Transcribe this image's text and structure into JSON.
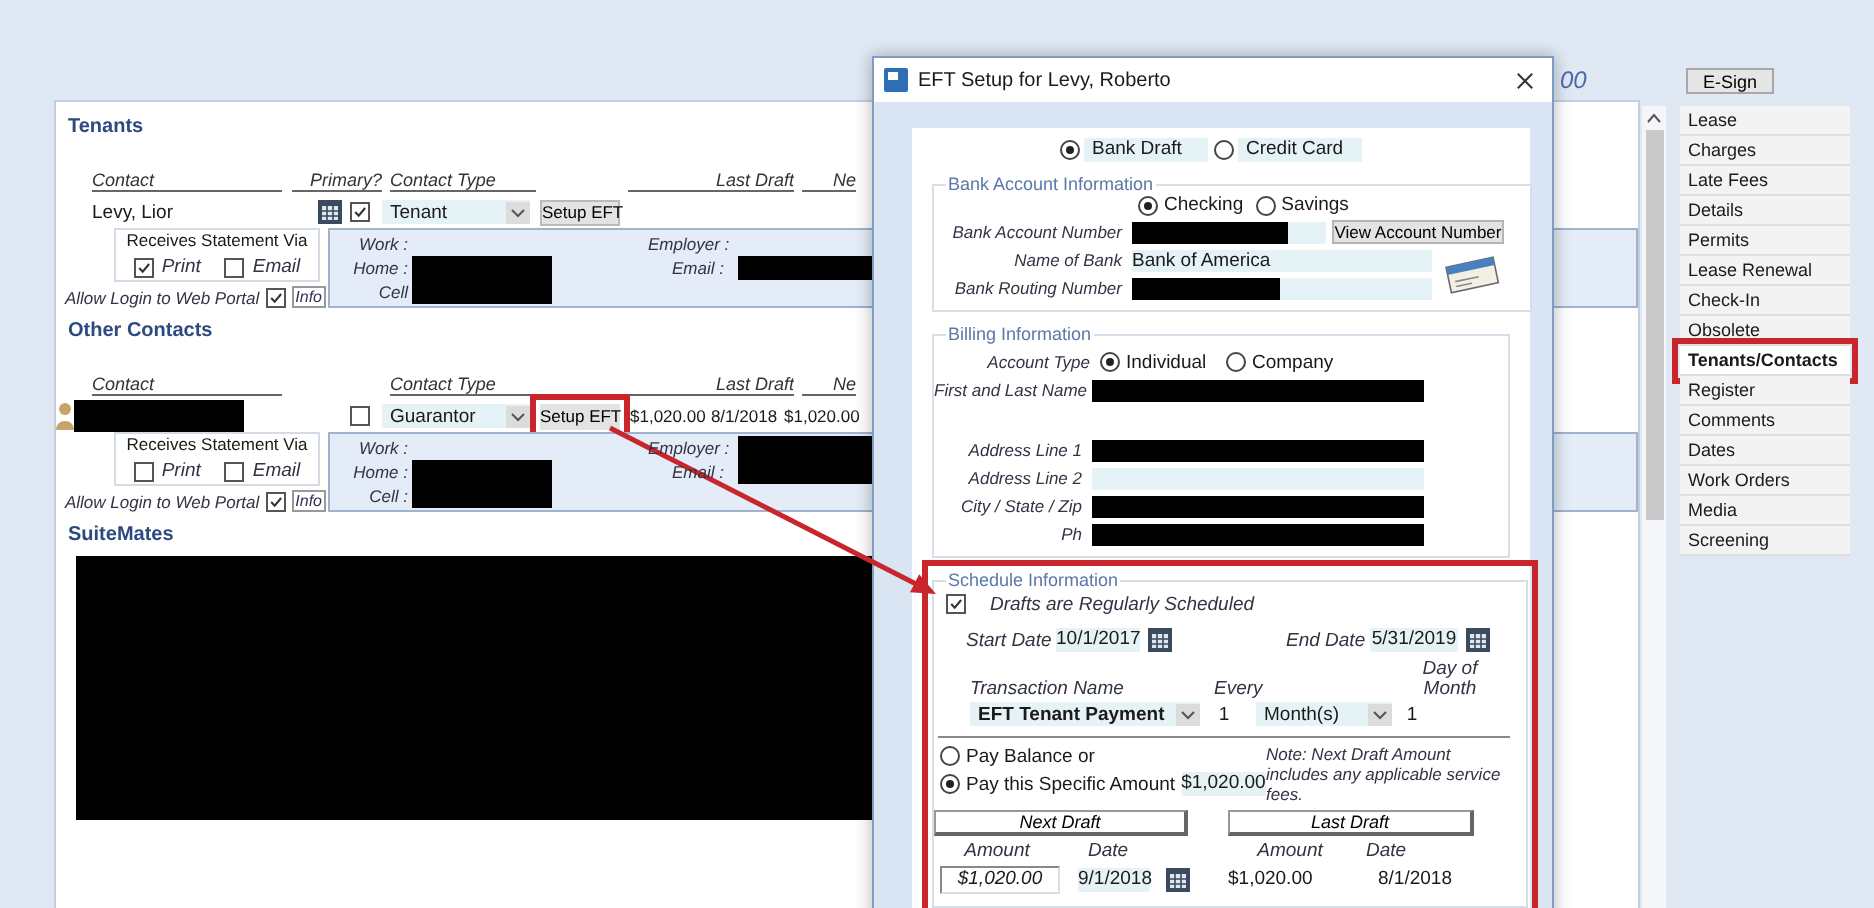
{
  "background_heading": "00",
  "sections": [
    {
      "kind": "tenant",
      "title": "Tenants",
      "headers": [
        {
          "kind": "contact",
          "label": "Contact"
        },
        {
          "kind": "primary",
          "label": "Primary?"
        },
        {
          "kind": "type",
          "label": "Contact Type"
        },
        {
          "kind": "last",
          "label": "Last Draft"
        },
        {
          "kind": "next",
          "label": "Ne"
        }
      ],
      "contacts": [
        {
          "name": "Levy, Lior",
          "name_redacted": false,
          "primary": true,
          "contact_type": "Tenant",
          "setup_button": "Setup EFT",
          "setup_highlighted": false,
          "statement": {
            "title": "Receives Statement Via",
            "options": [
              {
                "label": "Print",
                "checked": true
              },
              {
                "label": "Email",
                "checked": false
              }
            ]
          },
          "portal": {
            "label": "Allow Login to Web Portal",
            "checked": true,
            "link": "Info"
          },
          "phones": [
            {
              "label": "Work :",
              "redacted": false
            },
            {
              "label": "Home :",
              "redacted": true
            },
            {
              "label": "Cell",
              "redacted": true
            }
          ],
          "other_info": [
            {
              "label": "Employer :",
              "redacted": false
            },
            {
              "label": "Email :",
              "redacted": true
            }
          ]
        }
      ]
    },
    {
      "kind": "other",
      "title": "Other Contacts",
      "headers": [
        {
          "kind": "contact",
          "label": "Contact"
        },
        {
          "kind": "type",
          "label": "Contact Type"
        },
        {
          "kind": "last",
          "label": "Last Draft"
        },
        {
          "kind": "next",
          "label": "Ne"
        }
      ],
      "contacts": [
        {
          "name_redacted": true,
          "primary": false,
          "contact_type": "Guarantor",
          "setup_button": "Setup EFT",
          "setup_highlighted": true,
          "last_draft_amount": "$1,020.00",
          "last_draft_date": "8/1/2018",
          "next_draft_amount": "$1,020.00",
          "statement": {
            "title": "Receives Statement Via",
            "options": [
              {
                "label": "Print",
                "checked": false
              },
              {
                "label": "Email",
                "checked": false
              }
            ]
          },
          "portal": {
            "label": "Allow Login to Web Portal",
            "checked": true,
            "link": "Info"
          },
          "phones": [
            {
              "label": "Work :",
              "redacted": false
            },
            {
              "label": "Home :",
              "redacted": true
            },
            {
              "label": "Cell :",
              "redacted": true
            }
          ],
          "other_info": [
            {
              "label": "Employer :",
              "redacted": true
            },
            {
              "label": "Email :",
              "redacted": true
            }
          ]
        }
      ]
    }
  ],
  "suitemates": {
    "title": "SuiteMates",
    "redacted": true
  },
  "dialog": {
    "title": "EFT Setup for Levy, Roberto",
    "payment_methods": [
      {
        "label": "Bank Draft",
        "selected": true
      },
      {
        "label": "Credit Card",
        "selected": false
      }
    ],
    "bank": {
      "title": "Bank Account Information",
      "account_kinds": [
        {
          "label": "Checking",
          "selected": true
        },
        {
          "label": "Savings",
          "selected": false
        }
      ],
      "account_number": {
        "label": "Bank Account Number",
        "redacted": true
      },
      "view_button": "View Account Number",
      "bank_name": {
        "label": "Name of Bank",
        "value": "Bank of America"
      },
      "routing": {
        "label": "Bank Routing Number",
        "redacted": true
      }
    },
    "billing": {
      "title": "Billing Information",
      "account_type_label": "Account Type",
      "account_types": [
        {
          "label": "Individual",
          "selected": true
        },
        {
          "label": "Company",
          "selected": false
        }
      ],
      "name_fields": [
        {
          "label": "First and Last Name",
          "redacted": true
        }
      ],
      "address_fields": [
        {
          "label": "Address Line 1",
          "redacted": true
        },
        {
          "label": "Address Line 2",
          "redacted": false
        },
        {
          "label": "City / State / Zip",
          "redacted": true
        },
        {
          "label": "Ph",
          "redacted": true
        }
      ]
    },
    "schedule": {
      "title": "Schedule Information",
      "highlighted": true,
      "regular": {
        "label": "Drafts are Regularly Scheduled",
        "checked": true
      },
      "start": {
        "label": "Start Date",
        "value": "10/1/2017"
      },
      "end": {
        "label": "End Date",
        "value": "5/31/2019"
      },
      "transaction": {
        "label": "Transaction Name",
        "value": "EFT Tenant Payment"
      },
      "every": {
        "label": "Every",
        "value": "1",
        "unit": "Month(s)"
      },
      "day_of_month": {
        "label": "Day of Month",
        "value": "1"
      },
      "pay_options": [
        {
          "label": "Pay Balance or",
          "selected": false
        },
        {
          "label": "Pay this Specific Amount",
          "selected": true
        }
      ],
      "specific_amount": "$1,020.00",
      "note": "Note:  Next Draft Amount includes any applicable service fees.",
      "next_draft": {
        "title": "Next Draft",
        "amount_label": "Amount",
        "date_label": "Date",
        "amount": "$1,020.00",
        "date": "9/1/2018"
      },
      "last_draft": {
        "title": "Last Draft",
        "amount_label": "Amount",
        "date_label": "Date",
        "amount": "$1,020.00",
        "date": "8/1/2018"
      }
    }
  },
  "nav": {
    "button": "E-Sign",
    "items": [
      {
        "label": "Lease",
        "selected": false,
        "highlighted": false
      },
      {
        "label": "Charges",
        "selected": false,
        "highlighted": false
      },
      {
        "label": "Late Fees",
        "selected": false,
        "highlighted": false
      },
      {
        "label": "Details",
        "selected": false,
        "highlighted": false
      },
      {
        "label": "Permits",
        "selected": false,
        "highlighted": false
      },
      {
        "label": "Lease Renewal",
        "selected": false,
        "highlighted": false
      },
      {
        "label": "Check-In",
        "selected": false,
        "highlighted": false
      },
      {
        "label": "Obsolete",
        "selected": false,
        "highlighted": false
      },
      {
        "label": "Tenants/Contacts",
        "selected": true,
        "highlighted": true
      },
      {
        "label": "Register",
        "selected": false,
        "highlighted": false
      },
      {
        "label": "Comments",
        "selected": false,
        "highlighted": false
      },
      {
        "label": "Dates",
        "selected": false,
        "highlighted": false
      },
      {
        "label": "Work Orders",
        "selected": false,
        "highlighted": false
      },
      {
        "label": "Media",
        "selected": false,
        "highlighted": false
      },
      {
        "label": "Screening",
        "selected": false,
        "highlighted": false
      }
    ]
  },
  "annotation_arrow": true
}
